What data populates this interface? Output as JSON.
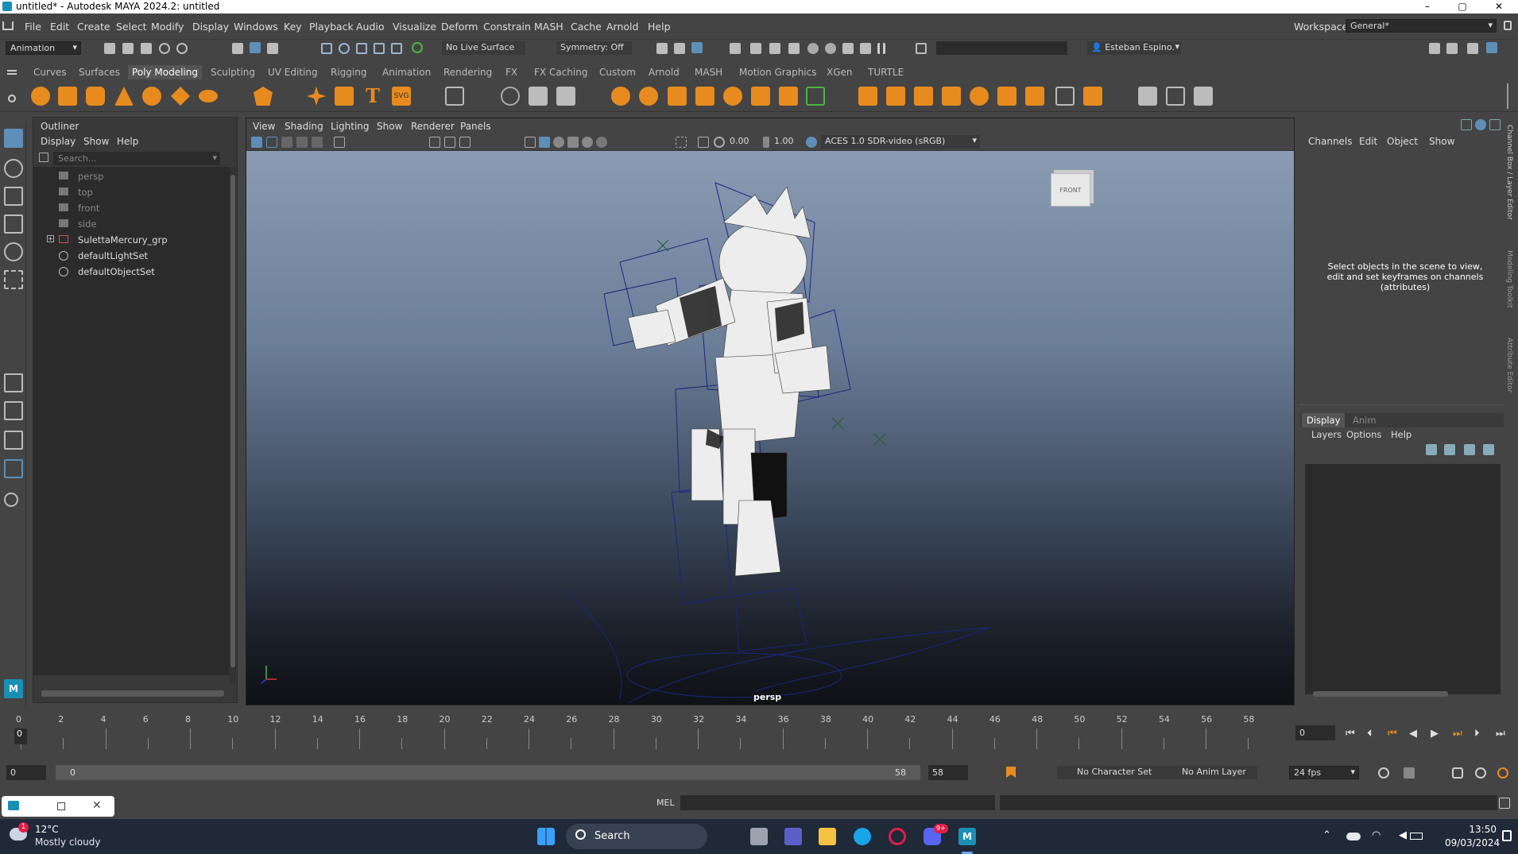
{
  "window": {
    "title": "untitled* - Autodesk MAYA 2024.2: untitled",
    "min": "–",
    "max": "▢",
    "close": "✕"
  },
  "menu": [
    "File",
    "Edit",
    "Create",
    "Select",
    "Modify",
    "Display",
    "Windows",
    "Key",
    "Playback",
    "Audio",
    "Visualize",
    "Deform",
    "Constrain",
    "MASH",
    "Cache",
    "Arnold",
    "Help"
  ],
  "workspace": {
    "label": "Workspace:",
    "value": "General*"
  },
  "statusline": {
    "mode": "Animation",
    "live_surface": "No Live Surface",
    "symmetry": "Symmetry: Off",
    "user": "Esteban Espino."
  },
  "shelf_tabs": [
    "Curves",
    "Surfaces",
    "Poly Modeling",
    "Sculpting",
    "UV Editing",
    "Rigging",
    "Animation",
    "Rendering",
    "FX",
    "FX Caching",
    "Custom",
    "Arnold",
    "MASH",
    "Motion Graphics",
    "XGen",
    "TURTLE"
  ],
  "outliner": {
    "title": "Outliner",
    "menus": [
      "Display",
      "Show",
      "Help"
    ],
    "search_placeholder": "Search...",
    "items": [
      {
        "label": "persp",
        "kind": "camera"
      },
      {
        "label": "top",
        "kind": "camera"
      },
      {
        "label": "front",
        "kind": "camera"
      },
      {
        "label": "side",
        "kind": "camera"
      },
      {
        "label": "SulettaMercury_grp",
        "kind": "group"
      },
      {
        "label": "defaultLightSet",
        "kind": "set"
      },
      {
        "label": "defaultObjectSet",
        "kind": "set"
      }
    ]
  },
  "viewport": {
    "menus": [
      "View",
      "Shading",
      "Lighting",
      "Show",
      "Renderer",
      "Panels"
    ],
    "exposure": "0.00",
    "gamma": "1.00",
    "colorspace": "ACES 1.0 SDR-video (sRGB)",
    "camera_label": "persp",
    "viewcube": "FRONT"
  },
  "channelbox": {
    "menus": [
      "Channels",
      "Edit",
      "Object",
      "Show"
    ],
    "message": "Select objects in the scene to view, edit and set keyframes on channels (attributes)"
  },
  "layers": {
    "tabs": [
      "Display",
      "Anim"
    ],
    "menus": [
      "Layers",
      "Options",
      "Help"
    ]
  },
  "sidetabs": [
    "Channel Box / Layer Editor",
    "Modeling Toolkit",
    "Attribute Editor"
  ],
  "timeline": {
    "ticks": [
      "0",
      "2",
      "4",
      "6",
      "8",
      "10",
      "12",
      "14",
      "16",
      "18",
      "20",
      "22",
      "24",
      "26",
      "28",
      "30",
      "32",
      "34",
      "36",
      "38",
      "40",
      "42",
      "44",
      "46",
      "48",
      "50",
      "52",
      "54",
      "56",
      "58"
    ],
    "current": "0",
    "current_field": "0"
  },
  "range": {
    "start": "0",
    "inner_start": "0",
    "inner_end": "58",
    "end": "58",
    "char_set": "No Character Set",
    "anim_layer": "No Anim Layer",
    "fps": "24 fps"
  },
  "cmd": {
    "lang": "MEL"
  },
  "taskbar": {
    "temp": "12°C",
    "weather": "Mostly cloudy",
    "search": "Search",
    "time": "13:50",
    "date": "09/03/2024",
    "badge": "1",
    "discord_badge": "9+"
  }
}
